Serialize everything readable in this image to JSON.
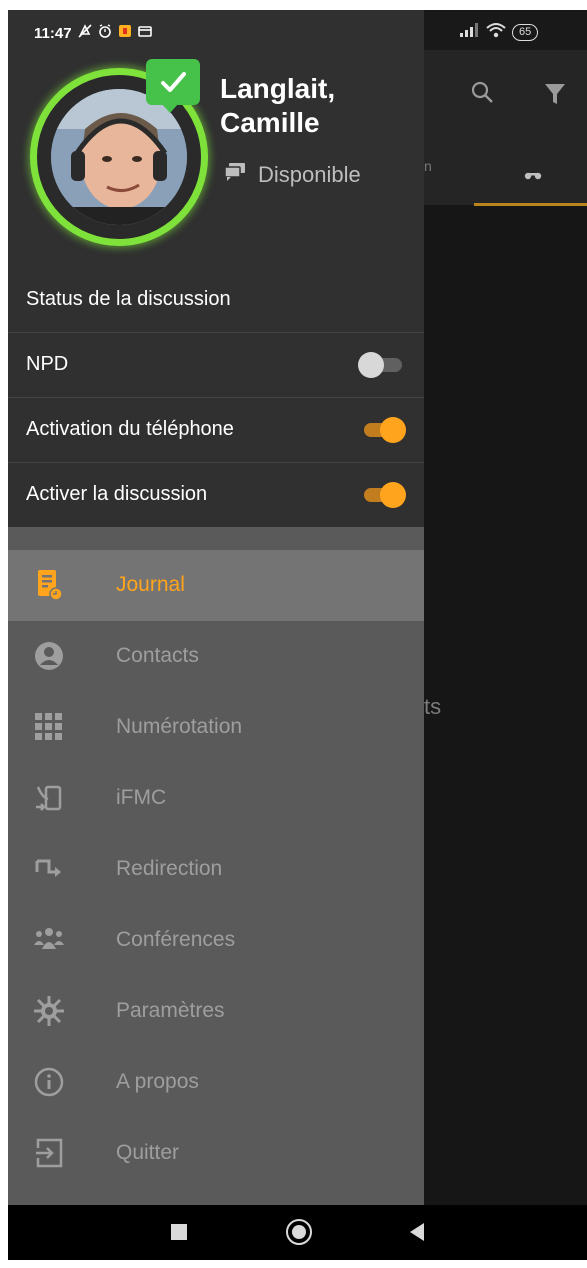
{
  "status_bar": {
    "time": "11:47",
    "battery": "65"
  },
  "profile": {
    "name_line1": "Langlait,",
    "name_line2": "Camille",
    "presence": "Disponible"
  },
  "section_title": "Status de la discussion",
  "toggles": [
    {
      "label": "NPD",
      "state": "off"
    },
    {
      "label": "Activation du téléphone",
      "state": "on"
    },
    {
      "label": "Activer la discussion",
      "state": "on"
    }
  ],
  "menu": [
    {
      "label": "Journal",
      "icon": "journal-icon",
      "active": true
    },
    {
      "label": "Contacts",
      "icon": "contacts-icon"
    },
    {
      "label": "Numérotation",
      "icon": "dialpad-icon"
    },
    {
      "label": "iFMC",
      "icon": "ifmc-icon"
    },
    {
      "label": "Redirection",
      "icon": "redirection-icon"
    },
    {
      "label": "Conférences",
      "icon": "conferences-icon"
    },
    {
      "label": "Paramètres",
      "icon": "settings-icon"
    },
    {
      "label": "A propos",
      "icon": "info-icon"
    },
    {
      "label": "Quitter",
      "icon": "exit-icon"
    }
  ],
  "background": {
    "empty_text_fragment": "ts"
  },
  "colors": {
    "accent": "#ffa41c",
    "presence_green": "#46c14a",
    "ring_green": "#7ee23a"
  }
}
